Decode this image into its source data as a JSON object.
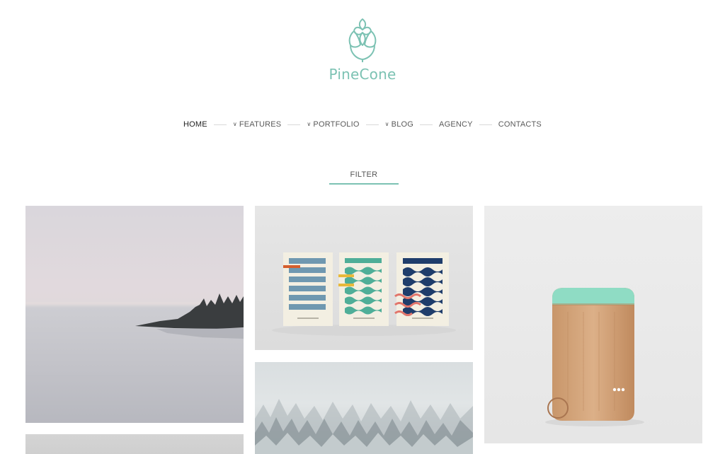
{
  "brand": {
    "name": "PineCone",
    "accent": "#7cc2b3"
  },
  "nav": {
    "items": [
      {
        "label": "HOME",
        "active": true,
        "dropdown": false
      },
      {
        "label": "FEATURES",
        "active": false,
        "dropdown": true
      },
      {
        "label": "PORTFOLIO",
        "active": false,
        "dropdown": true
      },
      {
        "label": "BLOG",
        "active": false,
        "dropdown": true
      },
      {
        "label": "AGENCY",
        "active": false,
        "dropdown": false
      },
      {
        "label": "CONTACTS",
        "active": false,
        "dropdown": false
      }
    ]
  },
  "filter": {
    "label": "FILTER"
  },
  "portfolio": {
    "items": [
      {
        "subject": "lake with pine-covered peninsula"
      },
      {
        "subject": "three wave pattern cards"
      },
      {
        "subject": "snowy pine forest"
      },
      {
        "subject": "bamboo power bank"
      },
      {
        "subject": "grey image"
      }
    ]
  }
}
